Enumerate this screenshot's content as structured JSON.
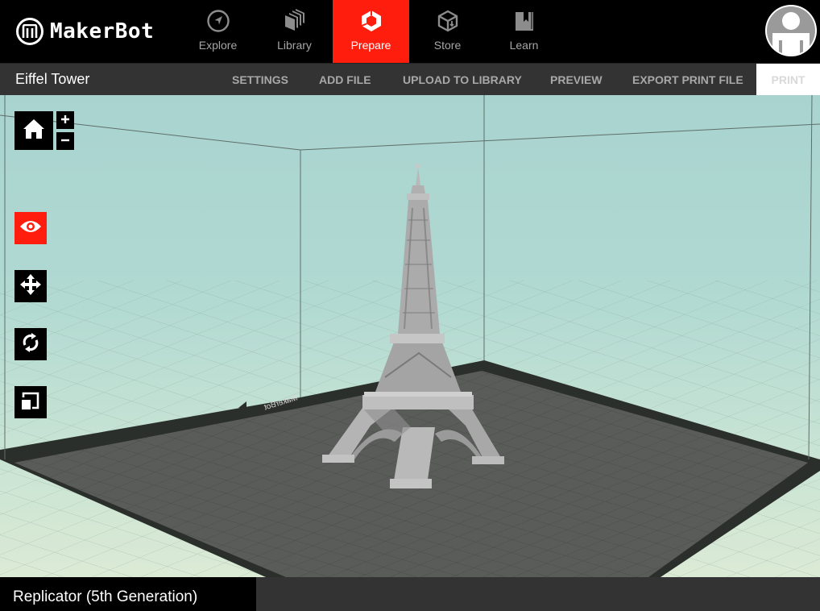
{
  "app": {
    "brand": "MakerBot"
  },
  "nav": {
    "items": [
      {
        "label": "Explore",
        "icon": "compass-icon",
        "active": false
      },
      {
        "label": "Library",
        "icon": "library-stack-icon",
        "active": false
      },
      {
        "label": "Prepare",
        "icon": "prepare-cube-icon",
        "active": true
      },
      {
        "label": "Store",
        "icon": "store-box-icon",
        "active": false
      },
      {
        "label": "Learn",
        "icon": "learn-book-icon",
        "active": false
      }
    ],
    "active_color": "#ff1d0e",
    "user_avatar": "user-avatar-icon"
  },
  "toolbar": {
    "project_title": "Eiffel Tower",
    "buttons": {
      "settings": "SETTINGS",
      "add_file": "ADD FILE",
      "upload": "UPLOAD TO LIBRARY",
      "preview": "PREVIEW",
      "export": "EXPORT PRINT FILE",
      "print": "PRINT"
    }
  },
  "viewport": {
    "model_name": "Eiffel Tower",
    "plate_label": "MakerBot",
    "view_tools": [
      {
        "name": "home-view",
        "icon": "home-icon"
      },
      {
        "name": "zoom-in",
        "icon": "plus-icon",
        "label": "+"
      },
      {
        "name": "zoom-out",
        "icon": "minus-icon",
        "label": "–"
      },
      {
        "name": "look",
        "icon": "eye-icon",
        "active": true
      },
      {
        "name": "move",
        "icon": "move-arrows-icon"
      },
      {
        "name": "rotate",
        "icon": "rotate-icon"
      },
      {
        "name": "scale",
        "icon": "scale-icon"
      }
    ]
  },
  "status": {
    "printer": "Replicator (5th Generation)"
  }
}
